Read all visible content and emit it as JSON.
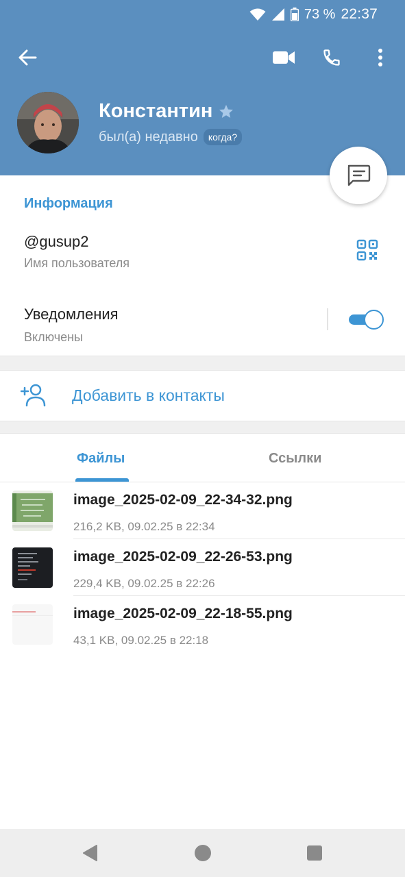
{
  "status_bar": {
    "battery": "73 %",
    "time": "22:37"
  },
  "icons": {
    "back": "arrow-left-icon",
    "video": "video-call-icon",
    "phone": "phone-icon",
    "more": "more-vertical-icon",
    "star": "star-icon",
    "message": "message-icon",
    "qr": "qr-code-icon",
    "add_contact": "add-person-icon"
  },
  "profile": {
    "name": "Константин",
    "status": "был(а) недавно",
    "when_badge": "когда?"
  },
  "info": {
    "title": "Информация",
    "username": "@gusup2",
    "username_label": "Имя пользователя",
    "notifications": "Уведомления",
    "notifications_state": "Включены",
    "notifications_enabled": true
  },
  "add_contact": {
    "label": "Добавить в контакты"
  },
  "tabs": [
    {
      "label": "Файлы",
      "active": true
    },
    {
      "label": "Ссылки",
      "active": false
    }
  ],
  "files": [
    {
      "name": "image_2025-02-09_22-34-32.png",
      "meta": "216,2 KB, 09.02.25 в 22:34"
    },
    {
      "name": "image_2025-02-09_22-26-53.png",
      "meta": "229,4 KB, 09.02.25 в 22:26"
    },
    {
      "name": "image_2025-02-09_22-18-55.png",
      "meta": "43,1 KB, 09.02.25 в 22:18"
    }
  ],
  "colors": {
    "header": "#5b8fbf",
    "accent": "#3d95d4"
  }
}
